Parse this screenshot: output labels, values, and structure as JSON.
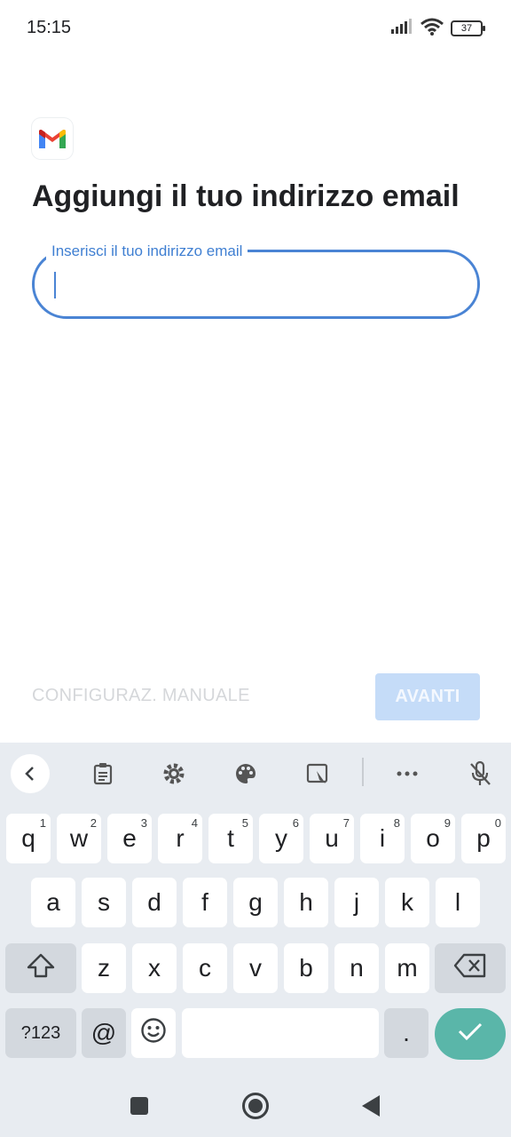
{
  "status_bar": {
    "time": "15:15",
    "battery": "37"
  },
  "app": {
    "logo_icon": "gmail-logo-icon"
  },
  "page": {
    "title": "Aggiungi il tuo indirizzo email"
  },
  "email_field": {
    "label": "Inserisci il tuo indirizzo email",
    "value": ""
  },
  "actions": {
    "manual_label": "CONFIGURAZ. MANUALE",
    "next_label": "AVANTI"
  },
  "keyboard": {
    "toolbar_icons": [
      "chevron-left-icon",
      "clipboard-icon",
      "settings-icon",
      "palette-icon",
      "floating-keyboard-icon",
      "more-icon",
      "mic-off-icon"
    ],
    "row1": [
      [
        "q",
        "1"
      ],
      [
        "w",
        "2"
      ],
      [
        "e",
        "3"
      ],
      [
        "r",
        "4"
      ],
      [
        "t",
        "5"
      ],
      [
        "y",
        "6"
      ],
      [
        "u",
        "7"
      ],
      [
        "i",
        "8"
      ],
      [
        "o",
        "9"
      ],
      [
        "p",
        "0"
      ]
    ],
    "row2": [
      "a",
      "s",
      "d",
      "f",
      "g",
      "h",
      "j",
      "k",
      "l"
    ],
    "row3": [
      "z",
      "x",
      "c",
      "v",
      "b",
      "n",
      "m"
    ],
    "symbols_label": "?123",
    "at_label": "@",
    "period_label": ".",
    "accent_color": "#5ab6a9"
  },
  "colors": {
    "focus": "#4a84d4",
    "next_disabled_bg": "#c5dcf8",
    "manual_disabled": "#d5d7da"
  }
}
